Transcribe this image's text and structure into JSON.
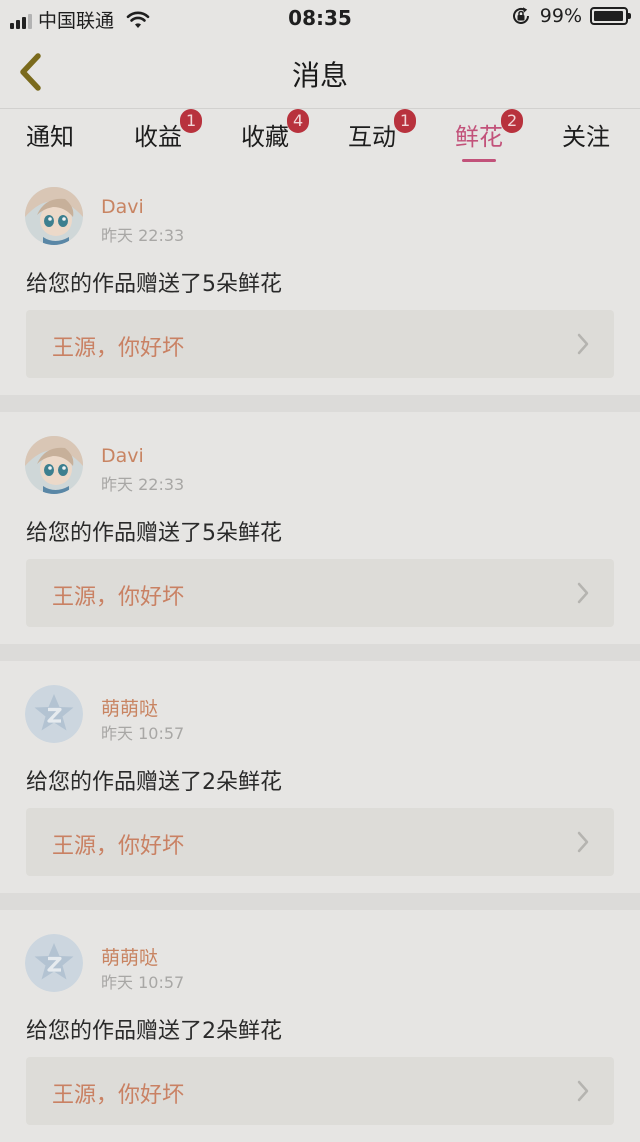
{
  "status_bar": {
    "carrier": "中国联通",
    "time": "08:35",
    "battery": "99%"
  },
  "navbar": {
    "title": "消息",
    "back_icon": "chevron-left-icon"
  },
  "tabs": [
    {
      "label": "通知",
      "badge": ""
    },
    {
      "label": "收益",
      "badge": "1"
    },
    {
      "label": "收藏",
      "badge": "4"
    },
    {
      "label": "互动",
      "badge": "1"
    },
    {
      "label": "鲜花",
      "badge": "2",
      "active": true
    },
    {
      "label": "关注",
      "badge": ""
    }
  ],
  "colors": {
    "accent": "#c2527a",
    "username": "#c88462",
    "badge": "#b8323d"
  },
  "messages": [
    {
      "user": "Davi",
      "time": "昨天 22:33",
      "text": "给您的作品赠送了5朵鲜花",
      "work": "王源，你好坏",
      "avatar": "anime-avatar"
    },
    {
      "user": "Davi",
      "time": "昨天 22:33",
      "text": "给您的作品赠送了5朵鲜花",
      "work": "王源，你好坏",
      "avatar": "anime-avatar"
    },
    {
      "user": "萌萌哒",
      "time": "昨天 10:57",
      "text": "给您的作品赠送了2朵鲜花",
      "work": "王源，你好坏",
      "avatar": "qzone-star-avatar"
    },
    {
      "user": "萌萌哒",
      "time": "昨天 10:57",
      "text": "给您的作品赠送了2朵鲜花",
      "work": "王源，你好坏",
      "avatar": "qzone-star-avatar"
    }
  ]
}
